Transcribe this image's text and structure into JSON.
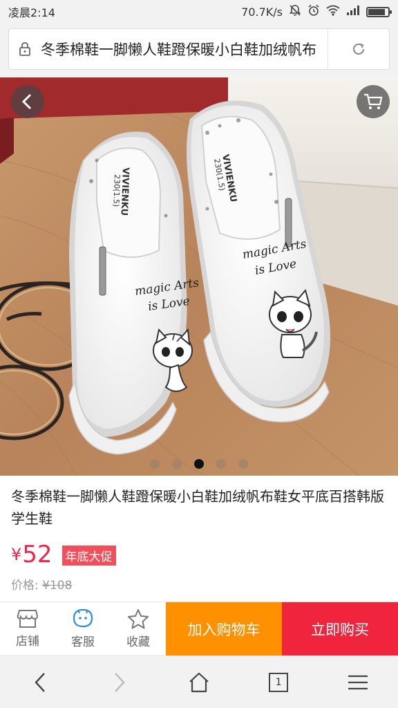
{
  "status_bar": {
    "time": "凌晨2:14",
    "network_speed": "70.7K/s",
    "battery_level": 0.85
  },
  "url_bar": {
    "text": "冬季棉鞋一脚懒人鞋蹬保暖小白鞋加绒帆布",
    "icons": {
      "lock": "lock-icon",
      "reload": "reload-icon"
    }
  },
  "gallery": {
    "slide_count": 5,
    "active_index": 2,
    "shoe_print_left": "magic Arts",
    "shoe_print_left_2": "is Love",
    "shoe_print_right": "magic Arts",
    "shoe_print_right_2": "is Love",
    "insole_brand": "VIVIENKU",
    "insole_size": "230(1.5)"
  },
  "product": {
    "title": "冬季棉鞋一脚懒人鞋蹬保暖小白鞋加绒帆布鞋女平底百搭韩版学生鞋",
    "currency": "¥",
    "price": "52",
    "promo_badge": "年底大促",
    "original_price_label": "价格:",
    "original_price": "¥108"
  },
  "action_bar": {
    "shop": "店铺",
    "service": "客服",
    "favorite": "收藏",
    "add_to_cart": "加入购物车",
    "buy_now": "立即购买"
  },
  "browser_bar": {
    "tab_count": "1"
  },
  "colors": {
    "price_red": "#f0244a",
    "add_cart_orange": "#ff9000",
    "buy_now_red": "#f0243d",
    "service_blue": "#2b8fd6"
  }
}
